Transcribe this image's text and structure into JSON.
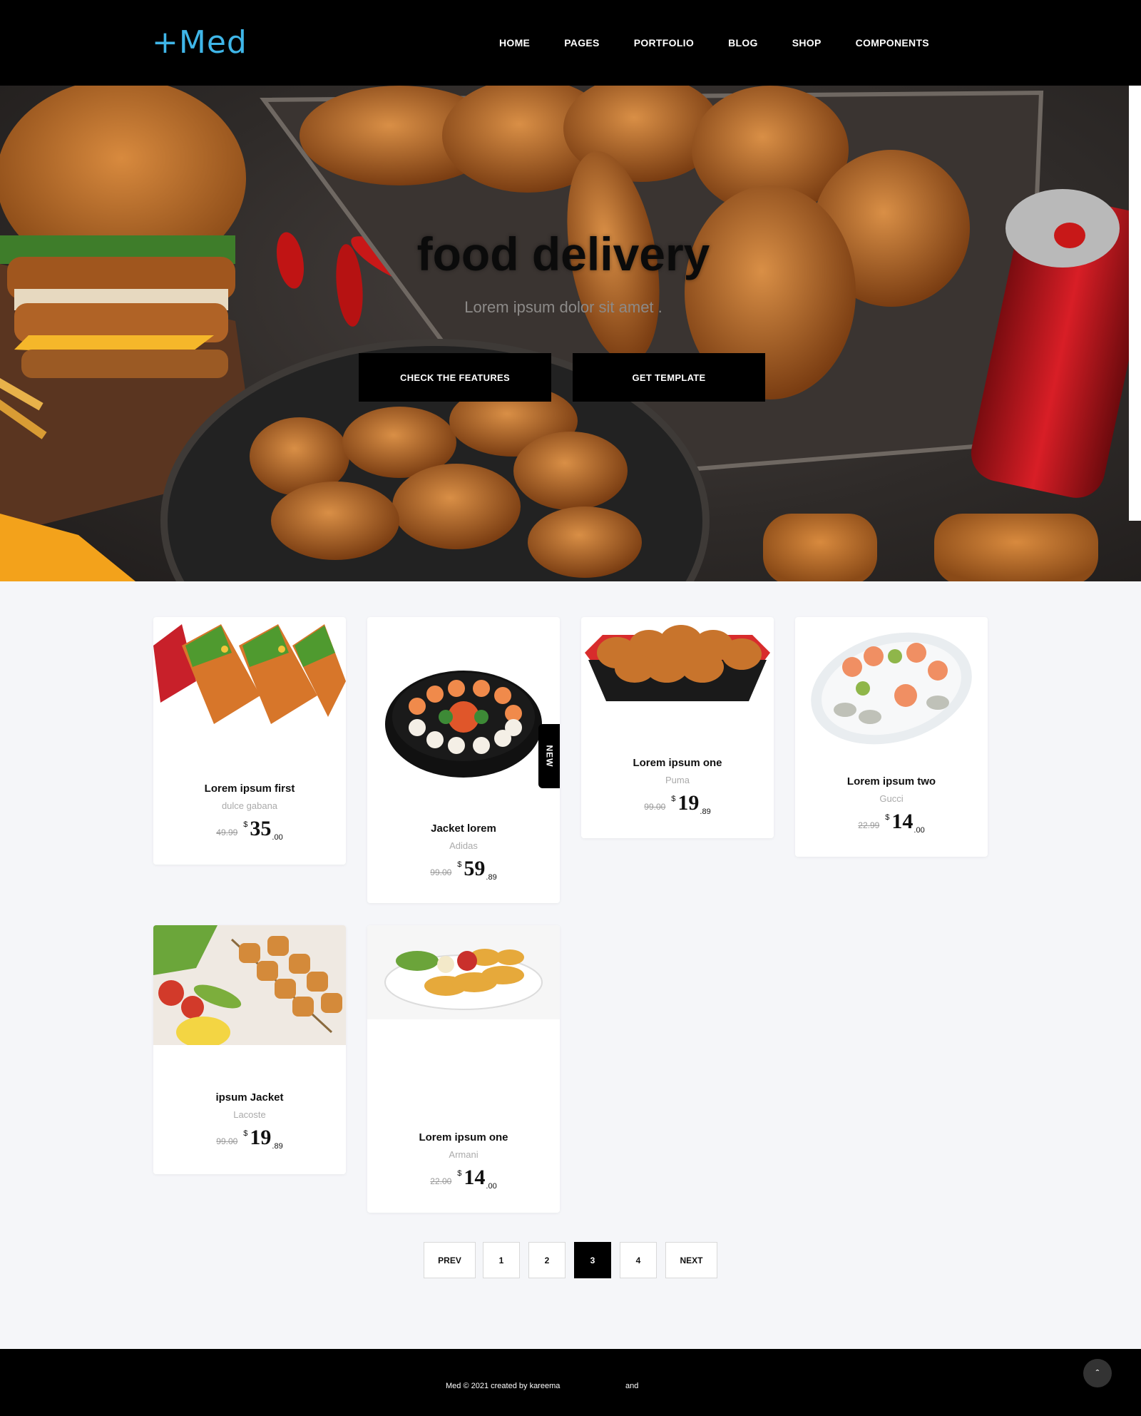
{
  "brand": {
    "logo": "+Med"
  },
  "nav": [
    "HOME",
    "PAGES",
    "PORTFOLIO",
    "BLOG",
    "SHOP",
    "COMPONENTS"
  ],
  "hero": {
    "title": "food delivery",
    "subtitle": "Lorem ipsum dolor sit amet .",
    "buttons": [
      "CHECK THE FEATURES",
      "GET TEMPLATE"
    ]
  },
  "products": [
    {
      "name": "Lorem ipsum first",
      "brand": "dulce gabana",
      "old_price": "49.99",
      "currency": "$",
      "price_main": "35",
      "price_cents": ".00",
      "image": "tacos-image"
    },
    {
      "name": "Jacket lorem",
      "brand": "Adidas",
      "old_price": "99.00",
      "currency": "$",
      "price_main": "59",
      "price_cents": ".89",
      "image": "sushi-platter-image",
      "badge": "NEW"
    },
    {
      "name": "Lorem ipsum one",
      "brand": "Puma",
      "old_price": "99.00",
      "currency": "$",
      "price_main": "19",
      "price_cents": ".89",
      "image": "fried-chicken-basket-image"
    },
    {
      "name": "Lorem ipsum two",
      "brand": "Gucci",
      "old_price": "22.99",
      "currency": "$",
      "price_main": "14",
      "price_cents": ".00",
      "image": "seafood-platter-image"
    },
    {
      "name": "ipsum Jacket",
      "brand": "Lacoste",
      "old_price": "99.00",
      "currency": "$",
      "price_main": "19",
      "price_cents": ".89",
      "image": "kebab-skewers-image"
    },
    {
      "name": "Lorem ipsum one",
      "brand": "Armani",
      "old_price": "22.00",
      "currency": "$",
      "price_main": "14",
      "price_cents": ".00",
      "image": "fried-shrimp-plate-image"
    }
  ],
  "pagination": {
    "prev": "PREV",
    "pages": [
      "1",
      "2",
      "3",
      "4"
    ],
    "current": "3",
    "next": "NEXT"
  },
  "footer": {
    "credit": "Med  ©  2021 created by kareema",
    "and": "and",
    "to_top": "ˆ"
  },
  "colors": {
    "accent": "#3fb6e8",
    "navbar": "#000000",
    "page_bg": "#f5f6f9"
  }
}
